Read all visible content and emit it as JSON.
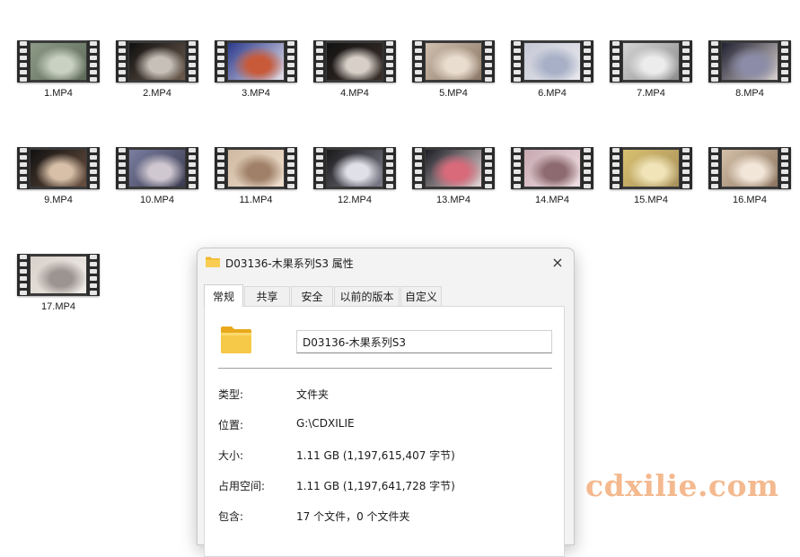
{
  "files": [
    {
      "label": "1.MP4",
      "colors": [
        "#8d9a86",
        "#c9d2c2",
        "#5e6b5a"
      ]
    },
    {
      "label": "2.MP4",
      "colors": [
        "#101010",
        "#c7c0b8",
        "#6c5a4c"
      ]
    },
    {
      "label": "3.MP4",
      "colors": [
        "#2b3a8c",
        "#c85a3a",
        "#e6e0e8"
      ]
    },
    {
      "label": "4.MP4",
      "colors": [
        "#121212",
        "#d8d0c8",
        "#3a2f2a"
      ]
    },
    {
      "label": "5.MP4",
      "colors": [
        "#cfbfae",
        "#e9ddd0",
        "#8a7664"
      ]
    },
    {
      "label": "6.MP4",
      "colors": [
        "#c6c8d4",
        "#a7b0c6",
        "#e8e8ee"
      ]
    },
    {
      "label": "7.MP4",
      "colors": [
        "#d4d4d4",
        "#ececec",
        "#8c8c8c"
      ]
    },
    {
      "label": "8.MP4",
      "colors": [
        "#202030",
        "#8c8ca8",
        "#d8d0d0"
      ]
    },
    {
      "label": "9.MP4",
      "colors": [
        "#111111",
        "#d8c0a8",
        "#6a5040"
      ]
    },
    {
      "label": "10.MP4",
      "colors": [
        "#7a7ea0",
        "#d0c8d0",
        "#3a3a50"
      ]
    },
    {
      "label": "11.MP4",
      "colors": [
        "#cfb8a0",
        "#a08068",
        "#efe0d0"
      ]
    },
    {
      "label": "12.MP4",
      "colors": [
        "#1a1a1a",
        "#e0e0e8",
        "#7c7c8c"
      ]
    },
    {
      "label": "13.MP4",
      "colors": [
        "#1c1c24",
        "#d86a7a",
        "#e6d6d6"
      ]
    },
    {
      "label": "14.MP4",
      "colors": [
        "#c8a8b0",
        "#8c6a70",
        "#efe0e4"
      ]
    },
    {
      "label": "15.MP4",
      "colors": [
        "#d8c070",
        "#f0e4b8",
        "#a8905a"
      ]
    },
    {
      "label": "16.MP4",
      "colors": [
        "#d4c0a8",
        "#f2e6d8",
        "#8c7460"
      ]
    },
    {
      "label": "17.MP4",
      "colors": [
        "#d8d0c8",
        "#9c9490",
        "#f2eeea"
      ]
    }
  ],
  "dialog": {
    "title": "D03136-木果系列S3 属性",
    "close_icon": "×",
    "tabs": [
      {
        "label": "常规",
        "active": true
      },
      {
        "label": "共享"
      },
      {
        "label": "安全"
      },
      {
        "label": "以前的版本"
      },
      {
        "label": "自定义"
      }
    ],
    "name_value": "D03136-木果系列S3",
    "rows": [
      {
        "k": "类型:",
        "v": "文件夹"
      },
      {
        "k": "位置:",
        "v": "G:\\CDXILIE"
      },
      {
        "k": "大小:",
        "v": "1.11 GB (1,197,615,407 字节)"
      },
      {
        "k": "占用空间:",
        "v": "1.11 GB (1,197,641,728 字节)"
      },
      {
        "k": "包含:",
        "v": "17 个文件，0 个文件夹"
      }
    ],
    "folder_color": "#f5c84a"
  },
  "watermark": "cdxilie.com"
}
